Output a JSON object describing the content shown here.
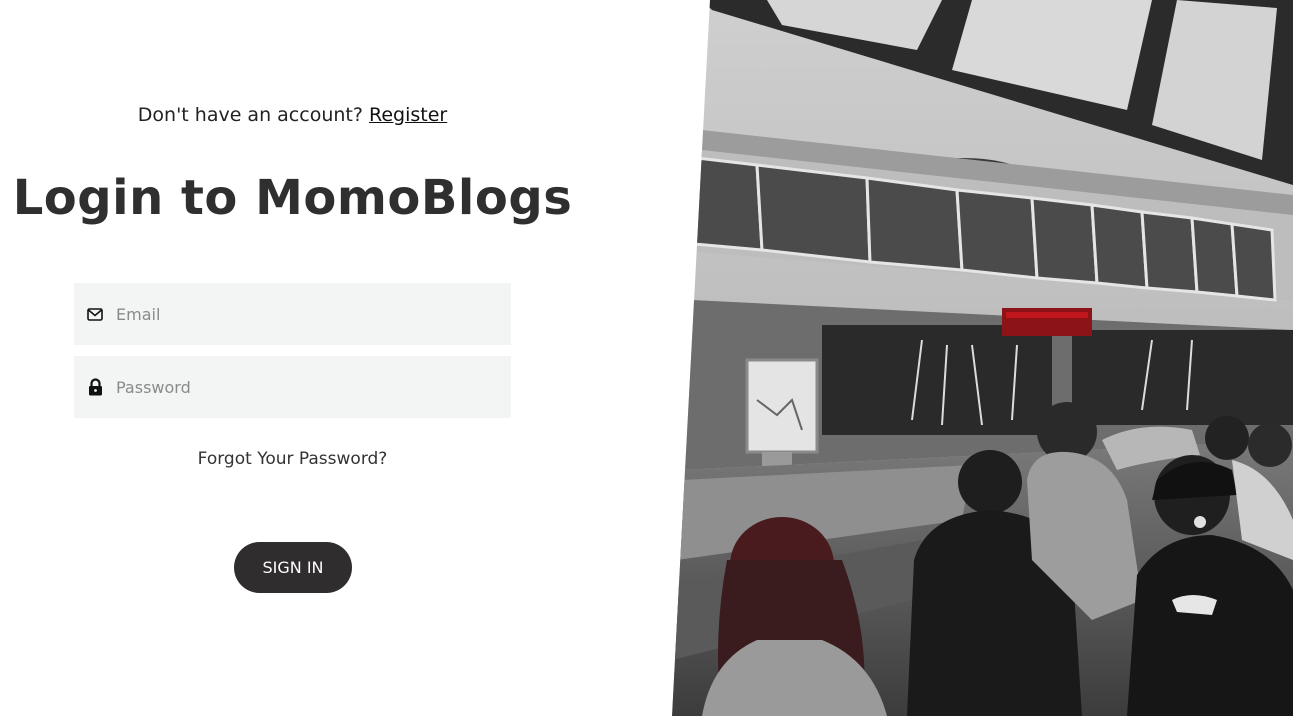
{
  "register": {
    "prompt": "Don't have an account?",
    "link": "Register"
  },
  "title": "Login to MomoBlogs",
  "email": {
    "placeholder": "Email",
    "icon": "mail-icon"
  },
  "password": {
    "placeholder": "Password",
    "icon": "lock-icon"
  },
  "forgot_label": "Forgot Your Password?",
  "signin_label": "SIGN IN",
  "colors": {
    "button": "#2f2d2d",
    "field_bg": "#f2f5f4",
    "accent_red": "#c0161c"
  }
}
